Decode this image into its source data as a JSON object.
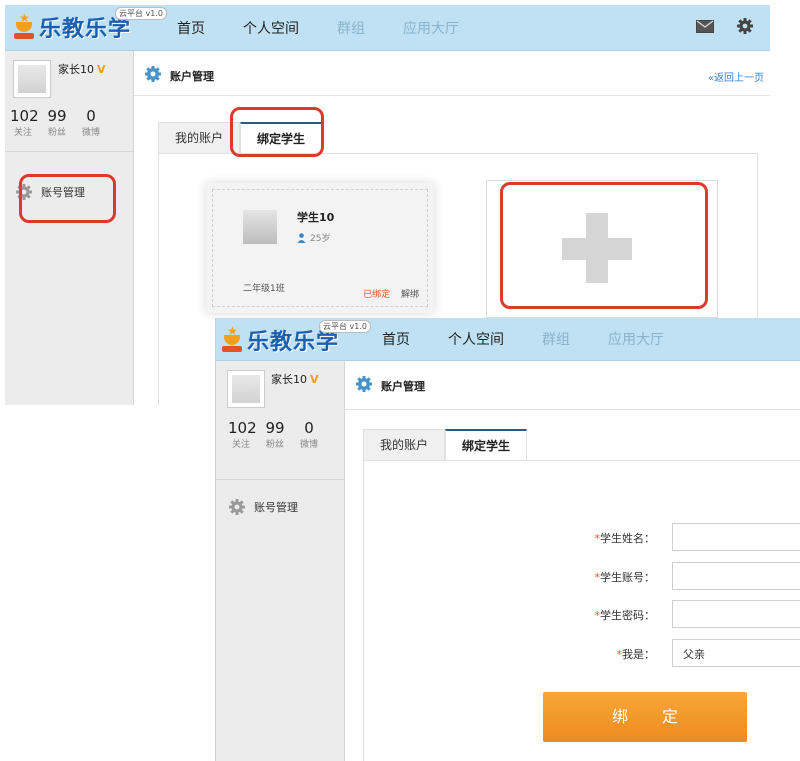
{
  "brand": {
    "logo_text": "乐教乐学",
    "version": "云平台 v1.0"
  },
  "nav": [
    {
      "label": "首页",
      "state": "active"
    },
    {
      "label": "个人空间",
      "state": "active"
    },
    {
      "label": "群组",
      "state": "disabled"
    },
    {
      "label": "应用大厅",
      "state": "disabled"
    }
  ],
  "header_icons": [
    "mail-icon",
    "gear-icon"
  ],
  "user": {
    "name": "家长10",
    "badge": "V"
  },
  "stats": [
    {
      "value": "102",
      "label": "关注"
    },
    {
      "value": "99",
      "label": "粉丝"
    },
    {
      "value": "0",
      "label": "微博"
    }
  ],
  "sidebar": {
    "item_label": "账号管理"
  },
  "page": {
    "title": "账户管理",
    "back_link": "«返回上一页"
  },
  "tabs": [
    {
      "label": "我的账户",
      "active": false
    },
    {
      "label": "绑定学生",
      "active": true
    }
  ],
  "student_card": {
    "name": "学生10",
    "age": "25岁",
    "class_name": "二年级1班",
    "bound_label": "已绑定",
    "unbind_label": "解绑"
  },
  "form": {
    "fields": [
      {
        "label": "学生姓名：",
        "required": true,
        "value": ""
      },
      {
        "label": "学生账号：",
        "required": true,
        "value": ""
      },
      {
        "label": "学生密码：",
        "required": true,
        "value": ""
      }
    ],
    "relation": {
      "label": "我是：",
      "required": true,
      "selected": "父亲"
    },
    "submit_label": "绑定"
  },
  "colors": {
    "header_bg": "#bfe1f3",
    "highlight": "#d83d2c",
    "button": "#f39b2a",
    "required_star": "#e1542a"
  }
}
